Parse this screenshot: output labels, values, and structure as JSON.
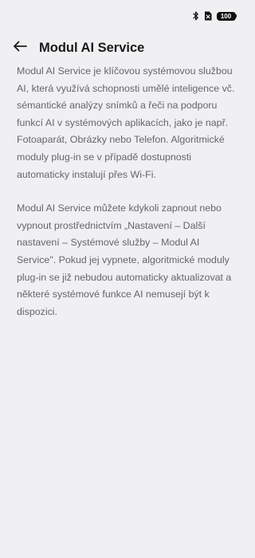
{
  "status_bar": {
    "icons": [
      "bluetooth-icon",
      "no-sim-icon",
      "battery-icon"
    ],
    "battery_level": "100"
  },
  "header": {
    "back_icon": "arrow-left-icon",
    "title": "Modul AI Service"
  },
  "body": {
    "paragraphs": [
      "Modul AI Service je klíčovou systémovou službou AI, která využívá schopnosti umělé inteligence vč. sémantické analýzy snímků a řeči na podporu funkcí AI v systémových aplikacích, jako je např. Fotoaparát, Obrázky nebo Telefon. Algoritmické moduly plug-in se v případě dostupnosti automaticky instalují přes Wi-Fi.",
      "Modul AI Service můžete kdykoli zapnout nebo vypnout prostřednictvím „Nastavení – Další nastavení – Systémové služby – Modul AI Service\". Pokud jej vypnete, algoritmické moduly plug-in se již nebudou automaticky aktualizovat a některé systémové funkce AI nemusejí být k dispozici."
    ]
  },
  "colors": {
    "background": "#f0f0f3",
    "title_text": "#1a1a1a",
    "body_text": "#666668"
  }
}
